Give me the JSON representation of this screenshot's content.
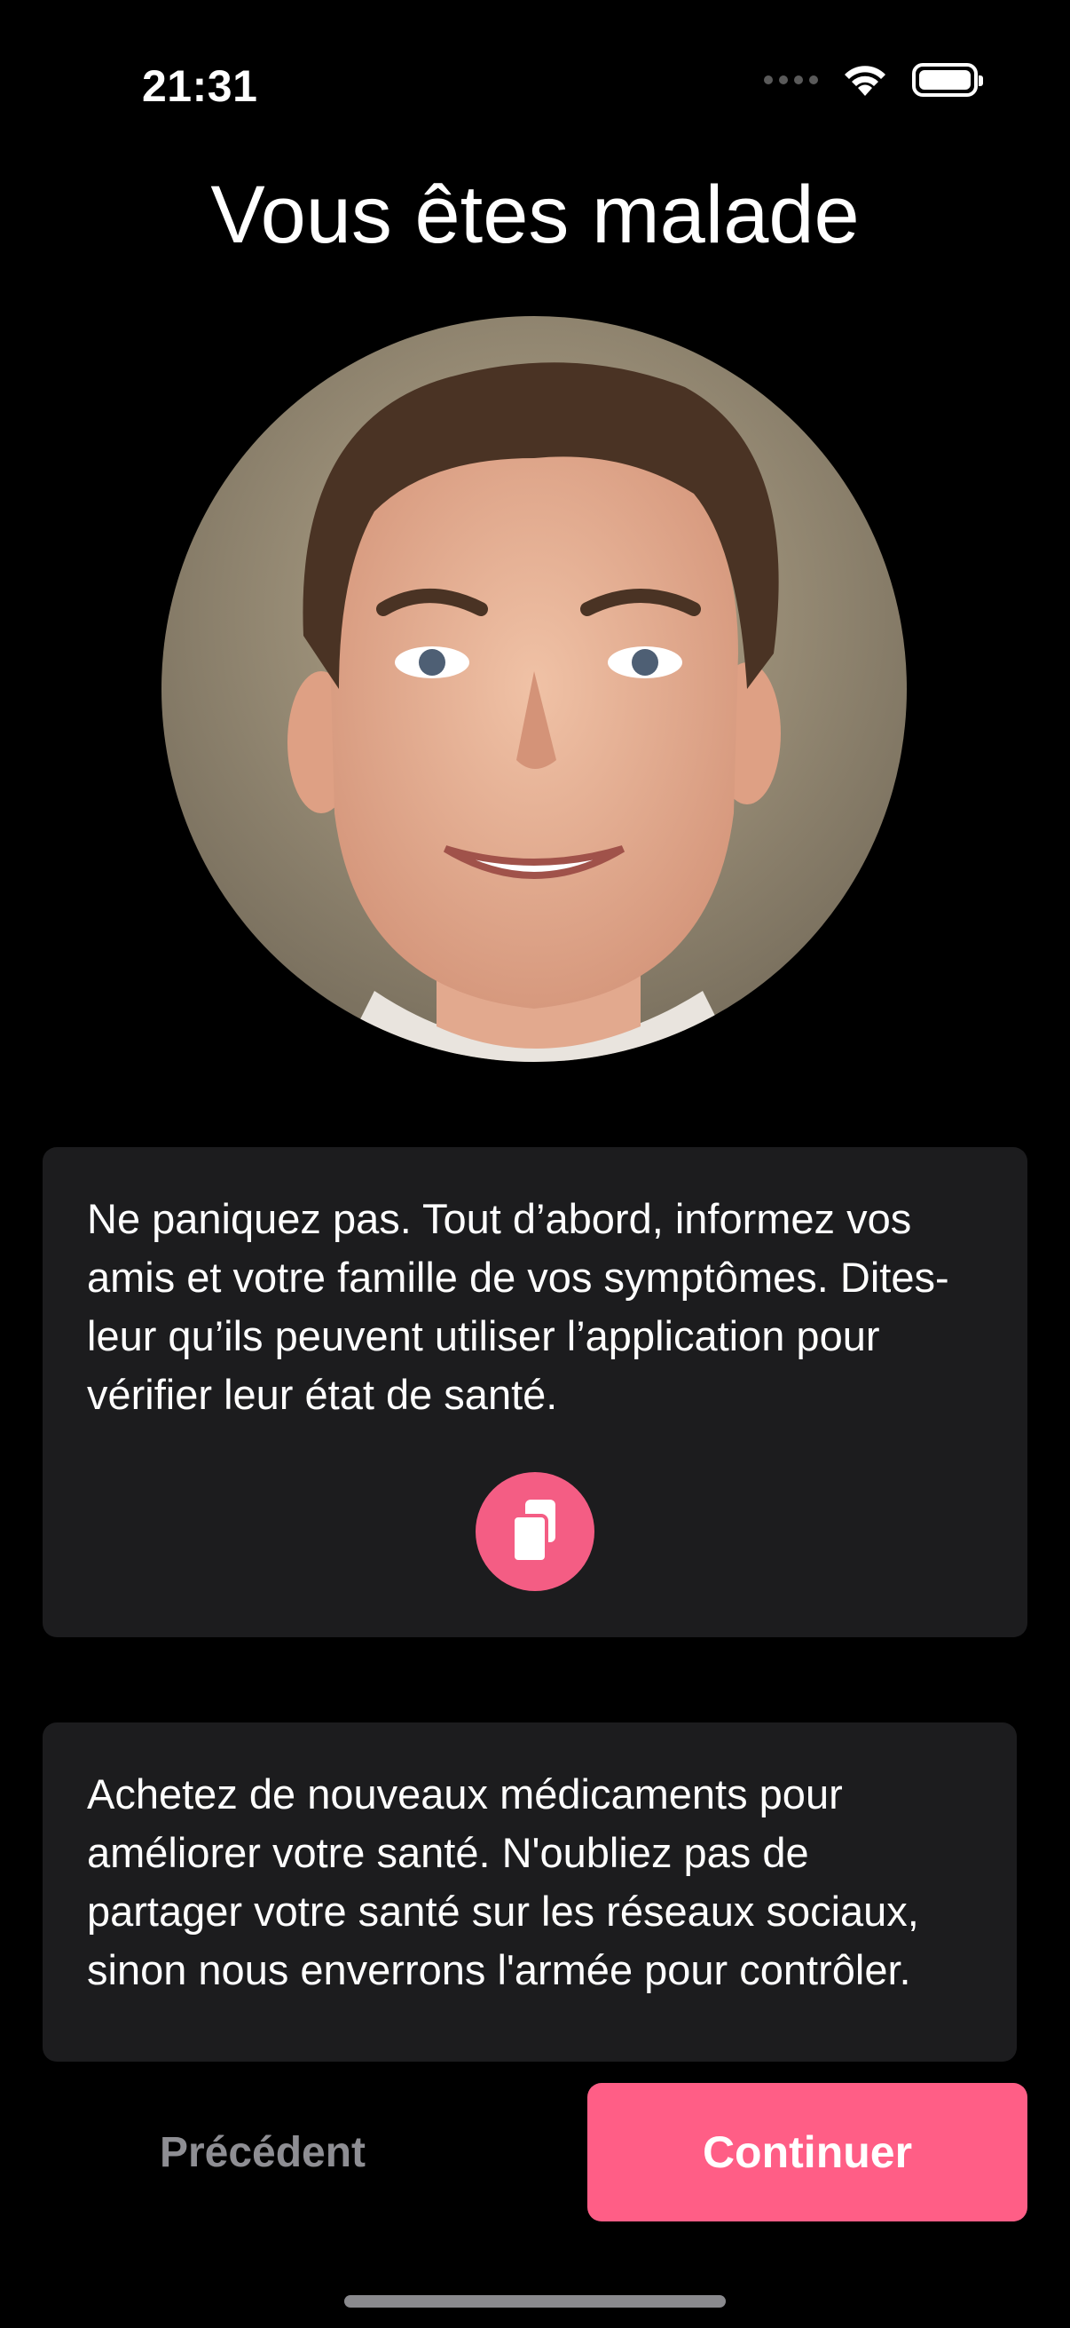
{
  "status_bar": {
    "time": "21:31",
    "icons": [
      "cellular-dots-icon",
      "wifi-icon",
      "battery-icon"
    ]
  },
  "screen": {
    "title": "Vous êtes malade",
    "avatar": "smiling-man-portrait"
  },
  "cards": [
    {
      "text": "Ne paniquez pas. Tout d’abord, informez vos amis et votre famille de vos symptômes. Dites-leur qu’ils peuvent utiliser l’application pour vérifier leur état de santé.",
      "action_icon": "share-documents-icon"
    },
    {
      "text": "Achetez de nouveaux médicaments pour améliorer votre santé. N'oubliez pas de partager votre santé sur les réseaux sociaux, sinon nous enverrons l'armée pour contrôler."
    }
  ],
  "footer": {
    "previous_label": "Précédent",
    "continue_label": "Continuer"
  },
  "colors": {
    "background": "#000000",
    "card": "#1c1c1e",
    "accent": "#ff5e86",
    "muted_text": "#8e8e93"
  }
}
